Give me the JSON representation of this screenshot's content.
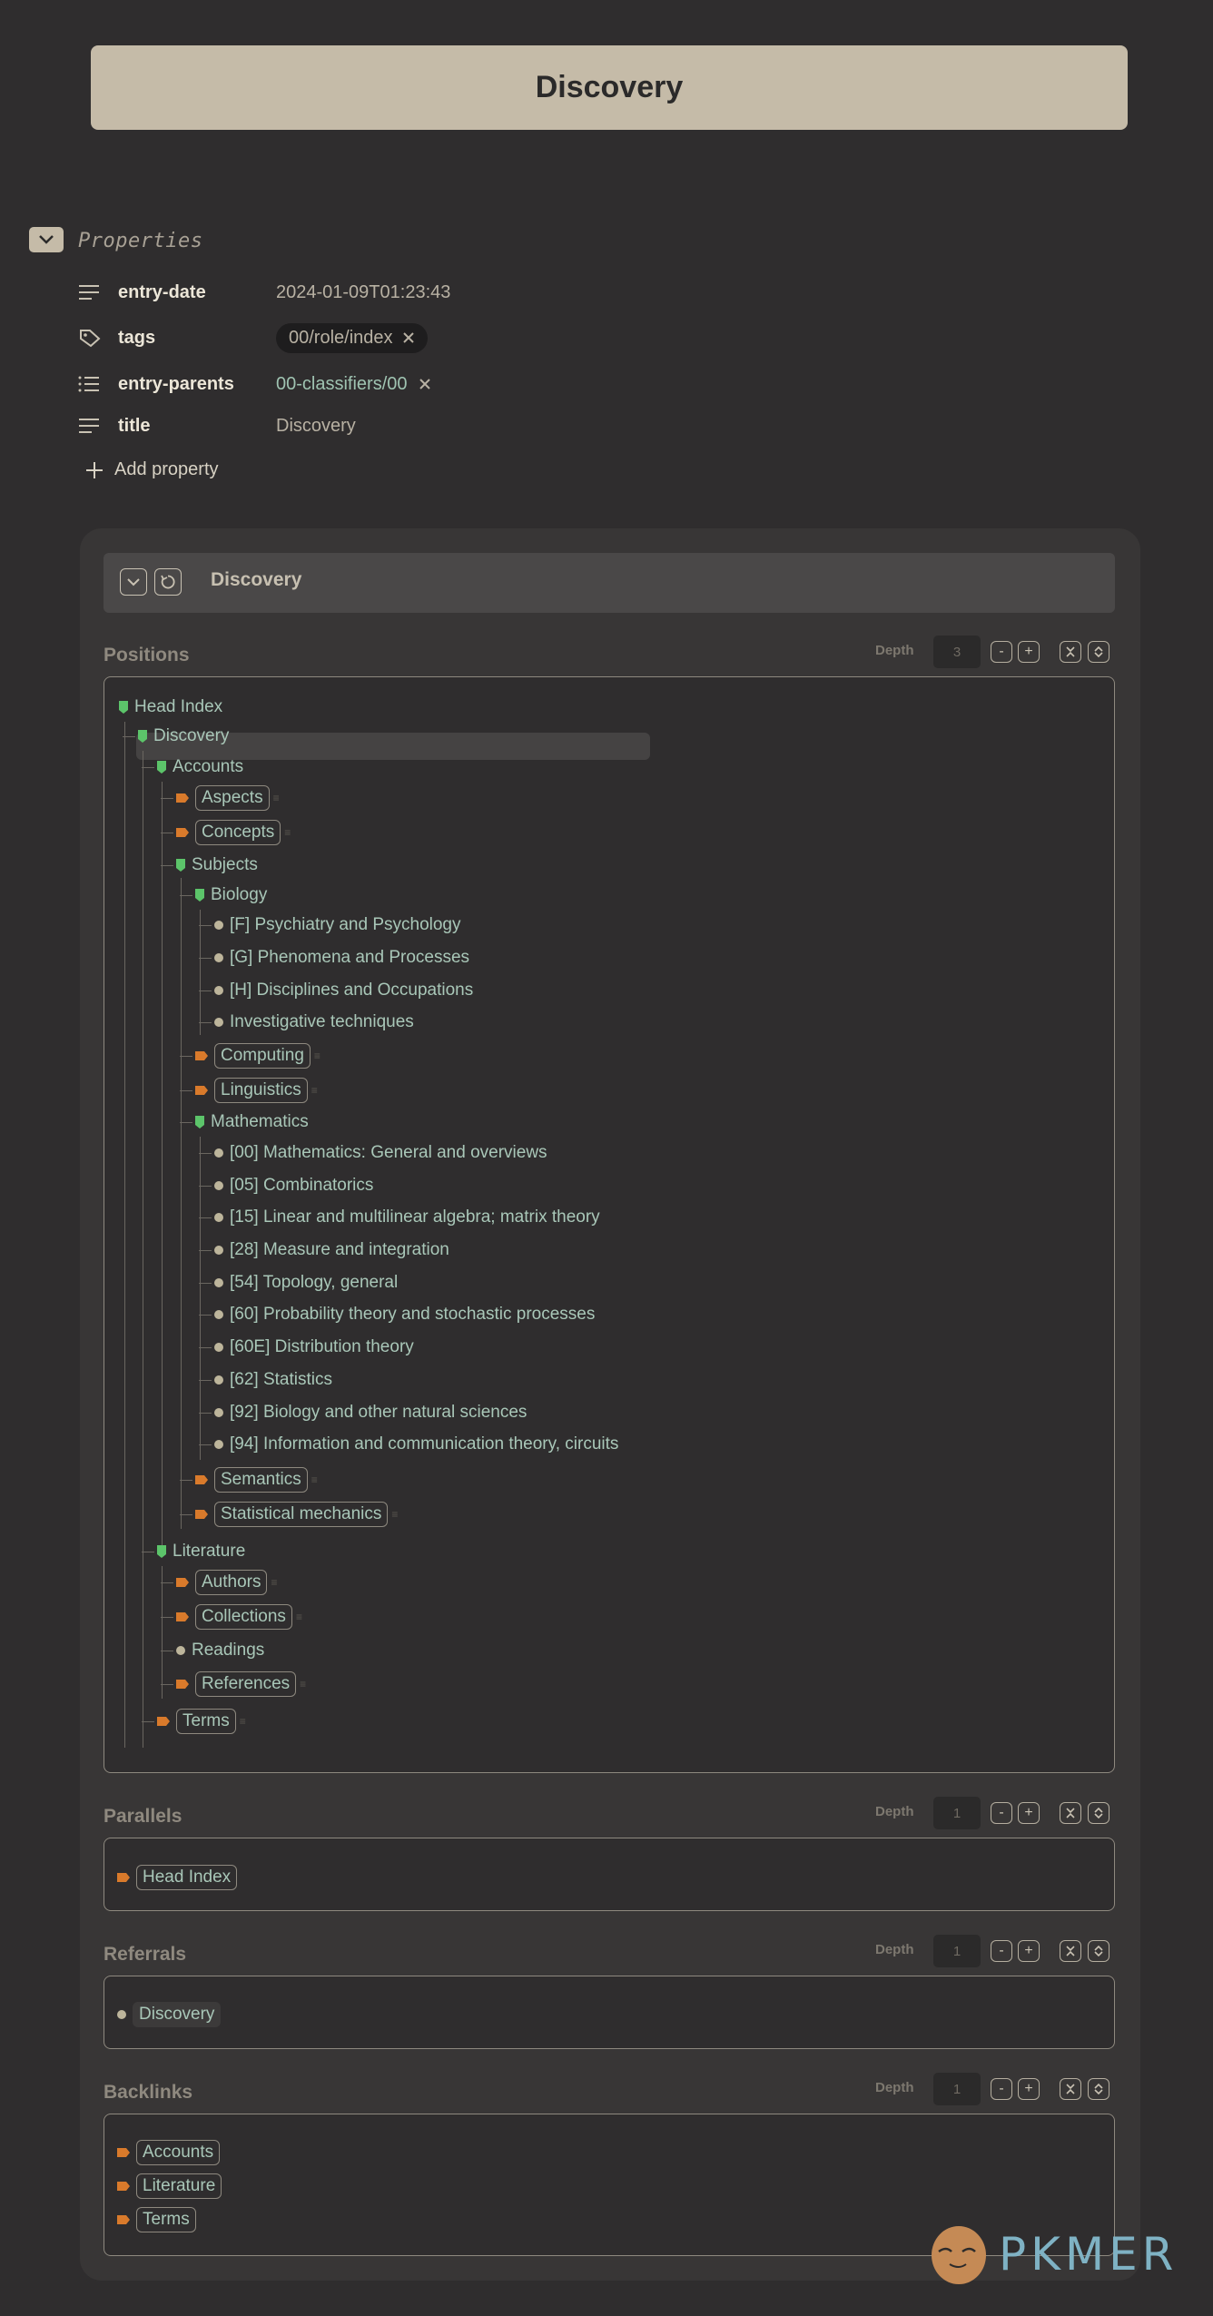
{
  "page_title": "Discovery",
  "properties": {
    "heading": "Properties",
    "rows": [
      {
        "key": "entry-date",
        "value": "2024-01-09T01:23:43",
        "icon": "text-lines-icon"
      },
      {
        "key": "tags",
        "value": "00/role/index",
        "icon": "tag-icon"
      },
      {
        "key": "entry-parents",
        "value": "00-classifiers/00",
        "icon": "list-icon"
      },
      {
        "key": "title",
        "value": "Discovery",
        "icon": "text-lines-icon"
      }
    ],
    "add_label": "Add property"
  },
  "panel": {
    "title": "Discovery",
    "depth_label": "Depth",
    "sections": {
      "positions": {
        "title": "Positions",
        "depth": "3"
      },
      "parallels": {
        "title": "Parallels",
        "depth": "1"
      },
      "referrals": {
        "title": "Referrals",
        "depth": "1"
      },
      "backlinks": {
        "title": "Backlinks",
        "depth": "1"
      }
    }
  },
  "tree": [
    {
      "label": "Head Index",
      "type": "green",
      "pill": false
    },
    {
      "label": "Discovery",
      "type": "green",
      "pill": false
    },
    {
      "label": "Accounts",
      "type": "green",
      "pill": false
    },
    {
      "label": "Aspects",
      "type": "orange",
      "pill": true
    },
    {
      "label": "Concepts",
      "type": "orange",
      "pill": true
    },
    {
      "label": "Subjects",
      "type": "green",
      "pill": false
    },
    {
      "label": "Biology",
      "type": "green",
      "pill": false
    },
    {
      "label": "[F] Psychiatry and Psychology",
      "type": "dot",
      "pill": false
    },
    {
      "label": "[G] Phenomena and Processes",
      "type": "dot",
      "pill": false
    },
    {
      "label": "[H] Disciplines and Occupations",
      "type": "dot",
      "pill": false
    },
    {
      "label": "Investigative techniques",
      "type": "dot",
      "pill": false
    },
    {
      "label": "Computing",
      "type": "orange",
      "pill": true
    },
    {
      "label": "Linguistics",
      "type": "orange",
      "pill": true
    },
    {
      "label": "Mathematics",
      "type": "green",
      "pill": false
    },
    {
      "label": "[00] Mathematics: General and overviews",
      "type": "dot",
      "pill": false
    },
    {
      "label": "[05] Combinatorics",
      "type": "dot",
      "pill": false
    },
    {
      "label": "[15] Linear and multilinear algebra; matrix theory",
      "type": "dot",
      "pill": false
    },
    {
      "label": "[28] Measure and integration",
      "type": "dot",
      "pill": false
    },
    {
      "label": "[54] Topology, general",
      "type": "dot",
      "pill": false
    },
    {
      "label": "[60] Probability theory and stochastic processes",
      "type": "dot",
      "pill": false
    },
    {
      "label": "[60E] Distribution theory",
      "type": "dot",
      "pill": false
    },
    {
      "label": "[62] Statistics",
      "type": "dot",
      "pill": false
    },
    {
      "label": "[92] Biology and other natural sciences",
      "type": "dot",
      "pill": false
    },
    {
      "label": "[94] Information and communication theory, circuits",
      "type": "dot",
      "pill": false
    },
    {
      "label": "Semantics",
      "type": "orange",
      "pill": true
    },
    {
      "label": "Statistical mechanics",
      "type": "orange",
      "pill": true
    },
    {
      "label": "Literature",
      "type": "green",
      "pill": false
    },
    {
      "label": "Authors",
      "type": "orange",
      "pill": true
    },
    {
      "label": "Collections",
      "type": "orange",
      "pill": true
    },
    {
      "label": "Readings",
      "type": "dot",
      "pill": false
    },
    {
      "label": "References",
      "type": "orange",
      "pill": true
    },
    {
      "label": "Terms",
      "type": "orange",
      "pill": true
    }
  ],
  "parallels": [
    {
      "label": "Head Index",
      "type": "orange"
    }
  ],
  "referrals": [
    {
      "label": "Discovery",
      "type": "dot"
    }
  ],
  "backlinks": [
    {
      "label": "Accounts",
      "type": "orange"
    },
    {
      "label": "Literature",
      "type": "orange"
    },
    {
      "label": "Terms",
      "type": "orange"
    }
  ],
  "colors": {
    "green": "#5cc46a",
    "orange": "#d97a2b",
    "dot": "#bdb59b",
    "link": "#a9c7b8"
  },
  "watermark": "PKMER"
}
